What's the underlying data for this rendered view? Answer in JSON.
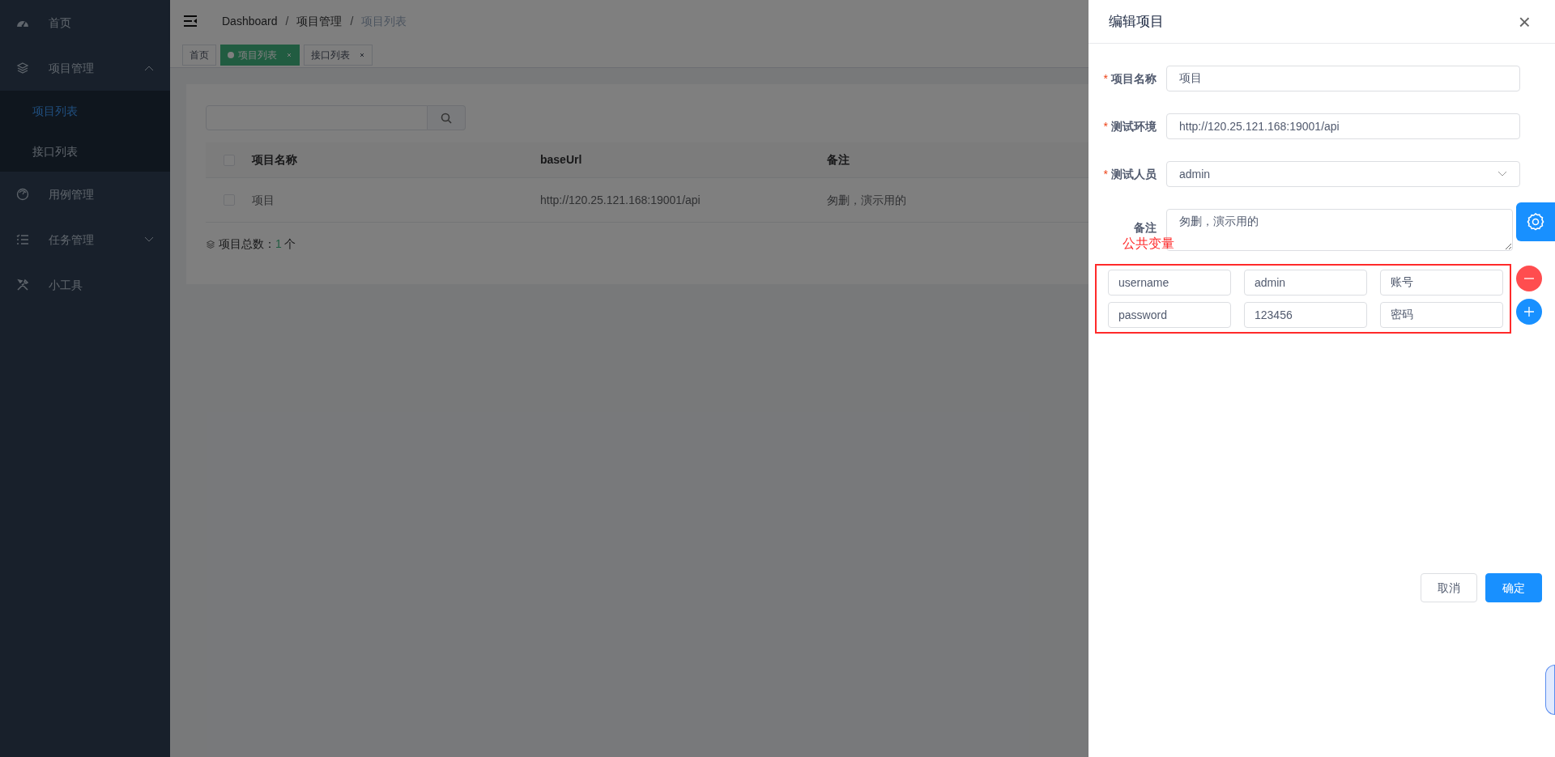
{
  "sidebar": {
    "items": [
      {
        "label": "首页",
        "selected": false
      },
      {
        "label": "项目管理",
        "selected": false,
        "expanded": true,
        "children": [
          {
            "label": "项目列表",
            "selected": true
          },
          {
            "label": "接口列表",
            "selected": false
          }
        ]
      },
      {
        "label": "用例管理",
        "selected": false
      },
      {
        "label": "任务管理",
        "selected": false,
        "expanded": false
      },
      {
        "label": "小工具",
        "selected": false
      }
    ]
  },
  "breadcrumb": [
    {
      "label": "Dashboard",
      "separator": "/"
    },
    {
      "label": "项目管理",
      "separator": "/"
    },
    {
      "label": "项目列表"
    }
  ],
  "tags": [
    {
      "label": "首页",
      "selected": false,
      "closable": false
    },
    {
      "label": "项目列表",
      "selected": true,
      "closable": true
    },
    {
      "label": "接口列表",
      "selected": false,
      "closable": true
    }
  ],
  "table": {
    "columns": [
      "项目名称",
      "baseUrl",
      "备注"
    ],
    "rows": [
      {
        "checked": false,
        "cells": [
          "项目",
          "http://120.25.121.168:19001/api",
          "匆删，演示用的"
        ]
      }
    ],
    "header_checked": false
  },
  "summary": {
    "label": "项目总数：",
    "count": "1",
    "unit": "个"
  },
  "drawer": {
    "title": "编辑项目",
    "close": "×",
    "fields": [
      {
        "label": "项目名称",
        "marker": "*",
        "kind": "input",
        "value": "项目"
      },
      {
        "label": "测试环境",
        "marker": "*",
        "kind": "input",
        "value": "http://120.25.121.168:19001/api"
      },
      {
        "label": "测试人员",
        "marker": "*",
        "kind": "select",
        "value": "admin"
      },
      {
        "label": "备注",
        "kind": "textarea",
        "value": "匆删，演示用的"
      }
    ],
    "variables_label": "公共变量",
    "variables": [
      {
        "name": "username",
        "value": "admin",
        "description": "账号"
      },
      {
        "name": "password",
        "value": "123456",
        "description": "密码"
      }
    ],
    "buttons": [
      {
        "label": "取消",
        "kind": "secondary"
      },
      {
        "label": "确定",
        "kind": "primary"
      }
    ]
  }
}
